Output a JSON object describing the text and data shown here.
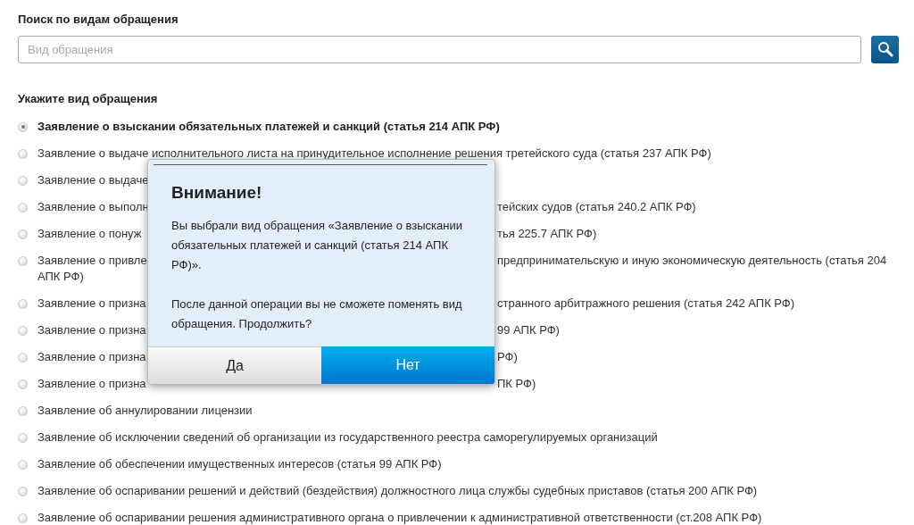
{
  "search": {
    "label": "Поиск по видам обращения",
    "placeholder": "Вид обращения"
  },
  "list": {
    "label": "Укажите вид обращения",
    "items": [
      {
        "kind": "full",
        "text": "Заявление о взыскании обязательных платежей и санкций (статья 214 АПК РФ)",
        "selected": true
      },
      {
        "kind": "full",
        "text": "Заявление о выдаче исполнительного листа на принудительное исполнение решения третейского суда (статья 237 АПК РФ)",
        "selected": false
      },
      {
        "kind": "covered",
        "text_before": "Заявление о выдаче",
        "selected": false
      },
      {
        "kind": "covered",
        "text_before": "Заявление о выполн",
        "text_after": "тейских судов (статья 240.2 АПК РФ)",
        "selected": false
      },
      {
        "kind": "covered",
        "text_before": "Заявление о понуж",
        "text_after": "тья 225.7 АПК РФ)",
        "selected": false
      },
      {
        "kind": "covered",
        "text_before": "Заявление о привле",
        "text_after": "предпринимательскую и иную экономическую деятельность (статья 204",
        "text_wrapped": "АПК РФ)",
        "selected": false
      },
      {
        "kind": "covered",
        "text_before": "Заявление о призна",
        "text_after": "странного арбитражного решения (статья 242 АПК РФ)",
        "selected": false
      },
      {
        "kind": "covered",
        "text_before": "Заявление о призна",
        "text_after": "99 АПК РФ)",
        "selected": false
      },
      {
        "kind": "covered",
        "text_before": "Заявление о призна",
        "text_after": "РФ)",
        "selected": false
      },
      {
        "kind": "covered",
        "text_before": "Заявление о призна",
        "text_after": "ПК РФ)",
        "selected": false
      },
      {
        "kind": "full",
        "text": "Заявление об аннулировании лицензии",
        "selected": false
      },
      {
        "kind": "full",
        "text": "Заявление об исключении сведений об организации из государственного реестра саморегулируемых организаций",
        "selected": false
      },
      {
        "kind": "full",
        "text": "Заявление об обеспечении имущественных интересов (статья 99 АПК РФ)",
        "selected": false
      },
      {
        "kind": "full",
        "text": "Заявление об оспаривании решений и действий (бездействия) должностного лица службы судебных приставов (статья 200 АПК РФ)",
        "selected": false
      },
      {
        "kind": "full",
        "text": "Заявление об оспаривании решения административного органа о привлечении к административной ответственности (ст.208 АПК РФ)",
        "selected": false
      }
    ]
  },
  "modal": {
    "title": "Внимание!",
    "paragraphs": [
      "Вы выбрали вид обращения «Заявление о взыскании обязательных платежей и санкций (статья 214 АПК РФ)».",
      "После данной операции вы не сможете поменять вид обращения. Продолжить?"
    ],
    "buttons": [
      {
        "label": "Да",
        "kind": "secondary"
      },
      {
        "label": "Нет",
        "kind": "primary"
      }
    ]
  }
}
